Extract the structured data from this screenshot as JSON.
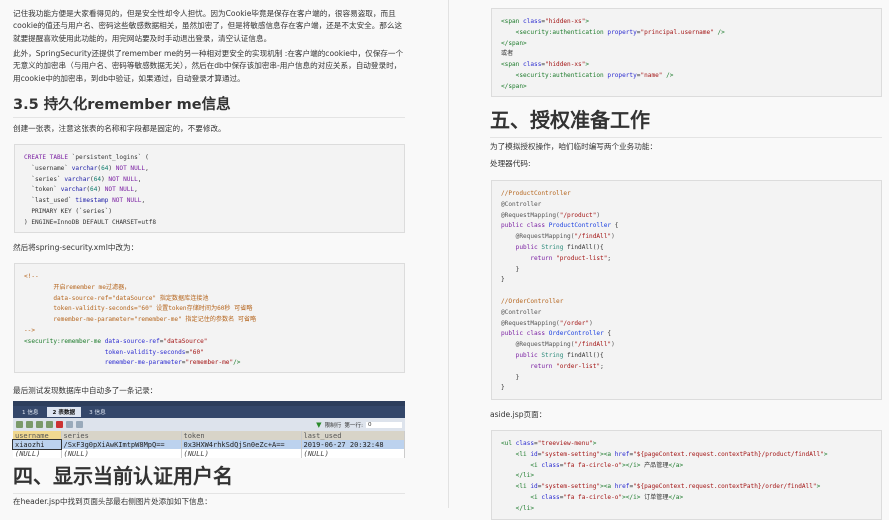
{
  "left": {
    "para1": "记住我功能方便是大家看得见的，但是安全性却令人担忧。因为Cookie毕竟是保存在客户端的，很容易盗取，而且cookie的值还与用户名、密码这些敏感数据相关，虽然加密了，但是将敏感信息存在客户端，还是不太安全。那么这就要提醒喜欢使用此功能的，用完网站要及时手动退出登录，清空认证信息。",
    "para2": "此外，SpringSecurity还提供了remember me的另一种相对更安全的实现机制 :在客户端的cookie中，仅保存一个无意义的加密串（与用户名、密码等敏感数据无关），然后在db中保存该加密串-用户信息的对应关系，自动登录时，用cookie中的加密串，到db中验证，如果通过，自动登录才算通过。",
    "heading_35": "3.5 持久化remember me信息",
    "para3": "创建一张表，注意这张表的名称和字段都是固定的，不要修改。",
    "sql_code": [
      [
        [
          "CREATE TABLE ",
          "kw"
        ],
        [
          "`persistent_logins` (",
          "pl"
        ]
      ],
      [
        [
          "  `username` ",
          "pl"
        ],
        [
          "varchar",
          "ty"
        ],
        [
          "(",
          "pl"
        ],
        [
          "64",
          "num"
        ],
        [
          ") ",
          "pl"
        ],
        [
          "NOT NULL",
          "kw"
        ],
        [
          ",",
          "pl"
        ]
      ],
      [
        [
          "  `series` ",
          "pl"
        ],
        [
          "varchar",
          "ty"
        ],
        [
          "(",
          "pl"
        ],
        [
          "64",
          "num"
        ],
        [
          ") ",
          "pl"
        ],
        [
          "NOT NULL",
          "kw"
        ],
        [
          ",",
          "pl"
        ]
      ],
      [
        [
          "  `token` ",
          "pl"
        ],
        [
          "varchar",
          "ty"
        ],
        [
          "(",
          "pl"
        ],
        [
          "64",
          "num"
        ],
        [
          ") ",
          "pl"
        ],
        [
          "NOT NULL",
          "kw"
        ],
        [
          ",",
          "pl"
        ]
      ],
      [
        [
          "  `last_used` ",
          "pl"
        ],
        [
          "timestamp",
          "ty"
        ],
        [
          " NOT NULL",
          "kw"
        ],
        [
          ",",
          "pl"
        ]
      ],
      [
        [
          "  PRIMARY KEY (`series`)",
          "pl"
        ]
      ],
      [
        [
          ") ENGINE=InnoDB DEFAULT CHARSET=utf8",
          "pl"
        ]
      ]
    ],
    "para4": "然后将spring-security.xml中改为：",
    "xml_code": [
      [
        [
          "<!--",
          "cm"
        ]
      ],
      [
        [
          "        开启remember me过滤器，",
          "cm"
        ]
      ],
      [
        [
          "        data-source-ref=\"dataSource\" 指定数据库连接池",
          "cm"
        ]
      ],
      [
        [
          "        token-validity-seconds=\"60\" 设置token存储时间为60秒 可省略",
          "cm"
        ]
      ],
      [
        [
          "        remember-me-parameter=\"remember-me\" 指定记住的参数名 可省略",
          "cm"
        ]
      ],
      [
        [
          "-->",
          "cm"
        ]
      ],
      [
        [
          "<security:remember-me ",
          "tag"
        ],
        [
          "data-source-ref",
          "attr"
        ],
        [
          "=",
          "pl"
        ],
        [
          "\"dataSource\"",
          "str"
        ]
      ],
      [
        [
          "                      token-validity-seconds",
          "attr"
        ],
        [
          "=",
          "pl"
        ],
        [
          "\"60\"",
          "str"
        ]
      ],
      [
        [
          "                      remember-me-parameter",
          "attr"
        ],
        [
          "=",
          "pl"
        ],
        [
          "\"remember-me\"",
          "str"
        ],
        [
          "/>",
          "tag"
        ]
      ]
    ],
    "para5": "最后测试发现数据库中自动多了一条记录：",
    "db_view": {
      "tabs": [
        "1 信息",
        "2 表数据",
        "3 信息"
      ],
      "columns": [
        "username",
        "series",
        "token",
        "last_used"
      ],
      "rows": [
        [
          "xiaozhi",
          "/SxF3g0pXiAwKImtpW8MpQ==",
          "0x3HXW4rhkSdQjSn0eZc+A==",
          "2019-06-27 20:32:48"
        ],
        [
          "(NULL)",
          "(NULL)",
          "(NULL)",
          "(NULL)"
        ]
      ],
      "toolbar_filter_label": "限制行",
      "toolbar_first_row_label": "第一行:",
      "toolbar_first_row_value": "0"
    },
    "heading_4": "四、显示当前认证用户名",
    "para6": "在header.jsp中找到页面头部最右侧图片处添加如下信息："
  },
  "right": {
    "span_code": [
      [
        [
          "<span ",
          "tag"
        ],
        [
          "class",
          "attr"
        ],
        [
          "=",
          "pl"
        ],
        [
          "\"hidden-xs\"",
          "str"
        ],
        [
          ">",
          "tag"
        ]
      ],
      [
        [
          "    <security:authentication ",
          "tag"
        ],
        [
          "property",
          "attr"
        ],
        [
          "=",
          "pl"
        ],
        [
          "\"principal.username\"",
          "str"
        ],
        [
          " />",
          "tag"
        ]
      ],
      [
        [
          "</span>",
          "tag"
        ]
      ],
      [
        [
          "或者",
          "pl"
        ]
      ],
      [
        [
          "<span ",
          "tag"
        ],
        [
          "class",
          "attr"
        ],
        [
          "=",
          "pl"
        ],
        [
          "\"hidden-xs\"",
          "str"
        ],
        [
          ">",
          "tag"
        ]
      ],
      [
        [
          "    <security:authentication ",
          "tag"
        ],
        [
          "property",
          "attr"
        ],
        [
          "=",
          "pl"
        ],
        [
          "\"name\"",
          "str"
        ],
        [
          " />",
          "tag"
        ]
      ],
      [
        [
          "</span>",
          "tag"
        ]
      ]
    ],
    "heading_5": "五、授权准备工作",
    "para1": "为了模拟授权操作，咱们临时编写两个业务功能：",
    "para2": "处理器代码:",
    "java_code": [
      [
        [
          "//ProductController",
          "cm"
        ]
      ],
      [
        [
          "@Controller",
          "an"
        ]
      ],
      [
        [
          "@RequestMapping(",
          "an"
        ],
        [
          "\"/product\"",
          "str"
        ],
        [
          ")",
          "an"
        ]
      ],
      [
        [
          "public class ",
          "kw"
        ],
        [
          "ProductController",
          "cls"
        ],
        [
          " {",
          "pl"
        ]
      ],
      [
        [
          "    @RequestMapping(",
          "an"
        ],
        [
          "\"/findAll\"",
          "str"
        ],
        [
          ")",
          "an"
        ]
      ],
      [
        [
          "    public ",
          "kw"
        ],
        [
          "String",
          "bi"
        ],
        [
          " findAll(){",
          "pl"
        ]
      ],
      [
        [
          "        return ",
          "kw"
        ],
        [
          "\"product-list\"",
          "str"
        ],
        [
          ";",
          "pl"
        ]
      ],
      [
        [
          "    }",
          "pl"
        ]
      ],
      [
        [
          "}",
          "pl"
        ]
      ],
      [
        [
          "",
          "pl"
        ]
      ],
      [
        [
          "//OrderController",
          "cm"
        ]
      ],
      [
        [
          "@Controller",
          "an"
        ]
      ],
      [
        [
          "@RequestMapping(",
          "an"
        ],
        [
          "\"/order\"",
          "str"
        ],
        [
          ")",
          "an"
        ]
      ],
      [
        [
          "public class ",
          "kw"
        ],
        [
          "OrderController",
          "cls"
        ],
        [
          " {",
          "pl"
        ]
      ],
      [
        [
          "    @RequestMapping(",
          "an"
        ],
        [
          "\"/findAll\"",
          "str"
        ],
        [
          ")",
          "an"
        ]
      ],
      [
        [
          "    public ",
          "kw"
        ],
        [
          "String",
          "bi"
        ],
        [
          " findAll(){",
          "pl"
        ]
      ],
      [
        [
          "        return ",
          "kw"
        ],
        [
          "\"order-list\"",
          "str"
        ],
        [
          ";",
          "pl"
        ]
      ],
      [
        [
          "    }",
          "pl"
        ]
      ],
      [
        [
          "}",
          "pl"
        ]
      ]
    ],
    "para3": "aside.jsp页面：",
    "aside_code": [
      [
        [
          "<ul ",
          "tag"
        ],
        [
          "class",
          "attr"
        ],
        [
          "=",
          "pl"
        ],
        [
          "\"treeview-menu\"",
          "str"
        ],
        [
          ">",
          "tag"
        ]
      ],
      [
        [
          "    <li ",
          "tag"
        ],
        [
          "id",
          "attr"
        ],
        [
          "=",
          "pl"
        ],
        [
          "\"system-setting\"",
          "str"
        ],
        [
          "><a ",
          "tag"
        ],
        [
          "href",
          "attr"
        ],
        [
          "=",
          "pl"
        ],
        [
          "\"${pageContext.request.contextPath}/product/findAll\"",
          "str"
        ],
        [
          ">",
          "tag"
        ]
      ],
      [
        [
          "        <i ",
          "tag"
        ],
        [
          "class",
          "attr"
        ],
        [
          "=",
          "pl"
        ],
        [
          "\"fa fa-circle-o\"",
          "str"
        ],
        [
          "></i>",
          "tag"
        ],
        [
          " 产品管理",
          "pl"
        ],
        [
          "</a>",
          "tag"
        ]
      ],
      [
        [
          "    </li>",
          "tag"
        ]
      ],
      [
        [
          "    <li ",
          "tag"
        ],
        [
          "id",
          "attr"
        ],
        [
          "=",
          "pl"
        ],
        [
          "\"system-setting\"",
          "str"
        ],
        [
          "><a ",
          "tag"
        ],
        [
          "href",
          "attr"
        ],
        [
          "=",
          "pl"
        ],
        [
          "\"${pageContext.request.contextPath}/order/findAll\"",
          "str"
        ],
        [
          ">",
          "tag"
        ]
      ],
      [
        [
          "        <i ",
          "tag"
        ],
        [
          "class",
          "attr"
        ],
        [
          "=",
          "pl"
        ],
        [
          "\"fa fa-circle-o\"",
          "str"
        ],
        [
          "></i>",
          "tag"
        ],
        [
          " 订单管理",
          "pl"
        ],
        [
          "</a>",
          "tag"
        ]
      ],
      [
        [
          "    </li>",
          "tag"
        ]
      ]
    ]
  }
}
